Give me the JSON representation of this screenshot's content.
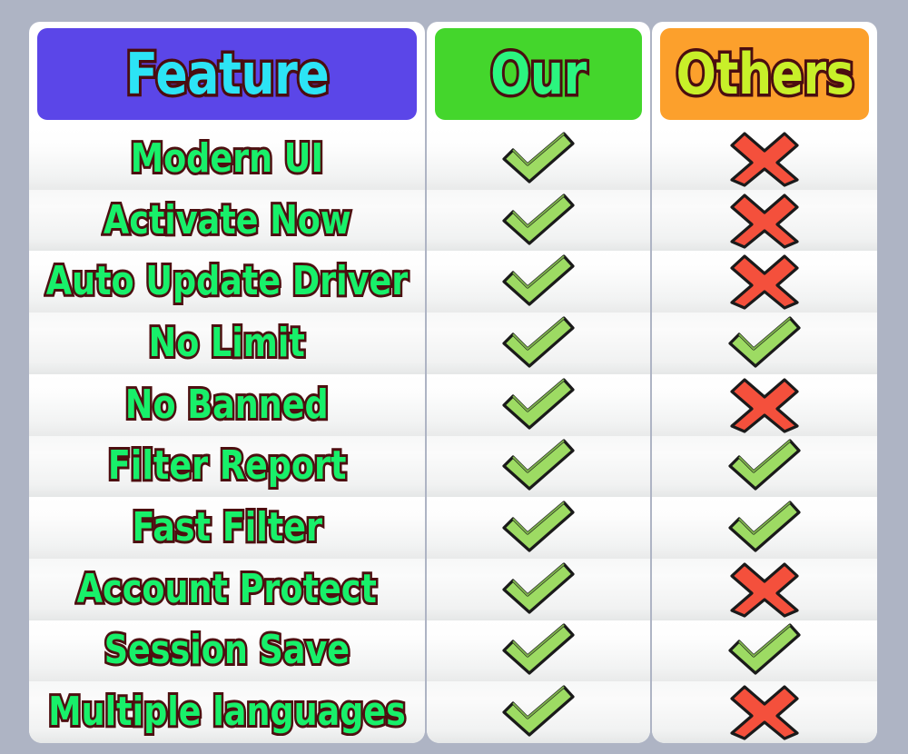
{
  "page": {
    "background_color": "#aeb4c4"
  },
  "table": {
    "columns": [
      {
        "key": "feature",
        "header_label": "Feature",
        "header_bg": "#5b46e8",
        "header_text_color": "#2ce4f5"
      },
      {
        "key": "our",
        "header_label": "Our",
        "header_bg": "#44d62c",
        "header_text_color": "#2bf57f"
      },
      {
        "key": "others",
        "header_label": "Others",
        "header_bg": "#fca02c",
        "header_text_color": "#c8f029"
      }
    ],
    "icons": {
      "check": "check-icon",
      "cross": "cross-icon",
      "check_color": "#9ddb63",
      "cross_color": "#f4503c",
      "outline_color": "#1a1a1a"
    },
    "rows": [
      {
        "feature": "Modern UI",
        "our": "check",
        "others": "cross"
      },
      {
        "feature": "Activate Now",
        "our": "check",
        "others": "cross"
      },
      {
        "feature": "Auto Update Driver",
        "our": "check",
        "others": "cross"
      },
      {
        "feature": "No Limit",
        "our": "check",
        "others": "check"
      },
      {
        "feature": "No Banned",
        "our": "check",
        "others": "cross"
      },
      {
        "feature": "Filter Report",
        "our": "check",
        "others": "check"
      },
      {
        "feature": "Fast Filter",
        "our": "check",
        "others": "check"
      },
      {
        "feature": "Account Protect",
        "our": "check",
        "others": "cross"
      },
      {
        "feature": "Session Save",
        "our": "check",
        "others": "check"
      },
      {
        "feature": "Multiple languages",
        "our": "check",
        "others": "cross"
      }
    ]
  }
}
